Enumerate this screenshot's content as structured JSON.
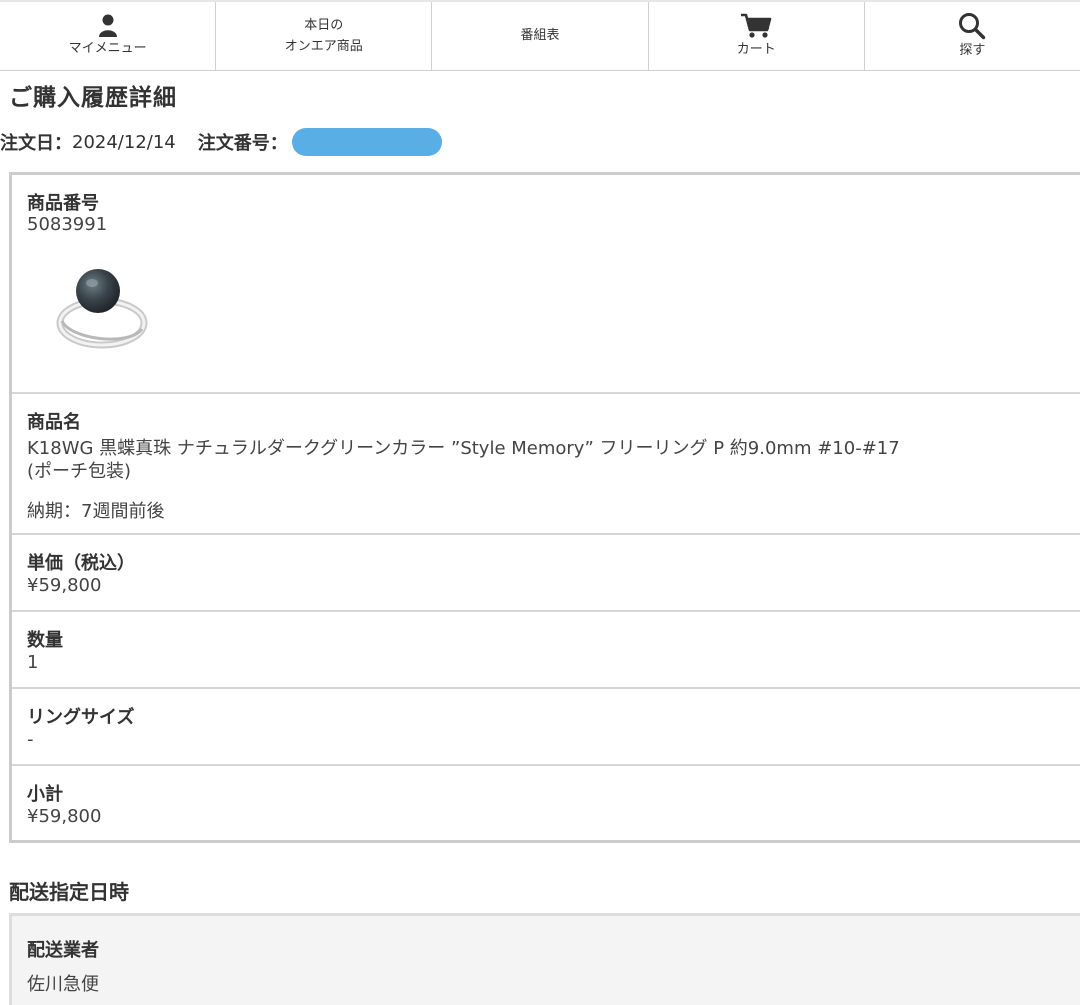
{
  "nav": {
    "items": [
      {
        "label": "マイメニュー",
        "icon": "person-icon"
      },
      {
        "label_line1": "本日の",
        "label_line2": "オンエア商品"
      },
      {
        "label": "番組表"
      },
      {
        "label": "カート",
        "icon": "cart-icon"
      },
      {
        "label": "探す",
        "icon": "search-icon"
      }
    ]
  },
  "page": {
    "title": "ご購入履歴詳細"
  },
  "order": {
    "date_label": "注文日：",
    "date_value": "2024/12/14",
    "number_label": "注文番号："
  },
  "item": {
    "product_number_label": "商品番号",
    "product_number": "5083991",
    "product_name_label": "商品名",
    "product_name_line1": "K18WG 黒蝶真珠 ナチュラルダークグリーンカラー ”Style Memory” フリーリング P 約9.0mm #10-#17",
    "product_name_line2": "(ポーチ包装)",
    "delivery_note": "納期：7週間前後",
    "unit_price_label": "単価（税込）",
    "unit_price": "¥59,800",
    "quantity_label": "数量",
    "quantity": "1",
    "ring_size_label": "リングサイズ",
    "ring_size": "-",
    "subtotal_label": "小計",
    "subtotal": "¥59,800"
  },
  "shipping": {
    "section_title": "配送指定日時",
    "carrier_label": "配送業者",
    "carrier": "佐川急便"
  },
  "colors": {
    "redaction": "#5aaee6",
    "border": "#cccccc"
  }
}
